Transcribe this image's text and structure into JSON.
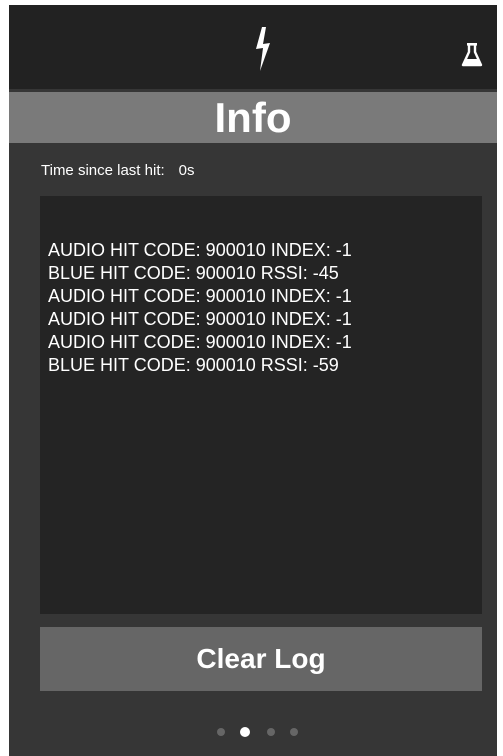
{
  "header": {
    "title": "Info",
    "left_icon": "lightning-bolt-icon",
    "right_icon": "flask-icon"
  },
  "status": {
    "label": "Time since last hit:",
    "value": "0s"
  },
  "log": {
    "lines": [
      "AUDIO HIT CODE: 900010 INDEX: -1",
      "BLUE HIT CODE: 900010 RSSI: -45",
      "AUDIO HIT CODE: 900010 INDEX: -1",
      "AUDIO HIT CODE: 900010 INDEX: -1",
      "AUDIO HIT CODE: 900010 INDEX: -1",
      "BLUE HIT CODE: 900010 RSSI: -59"
    ]
  },
  "actions": {
    "clear_label": "Clear Log"
  },
  "pager": {
    "count": 4,
    "active_index": 1
  },
  "colors": {
    "background": "#363636",
    "topbar": "#222222",
    "title_band": "#7a7a7a",
    "log_panel": "#242424",
    "button": "#666666",
    "text": "#ffffff"
  }
}
